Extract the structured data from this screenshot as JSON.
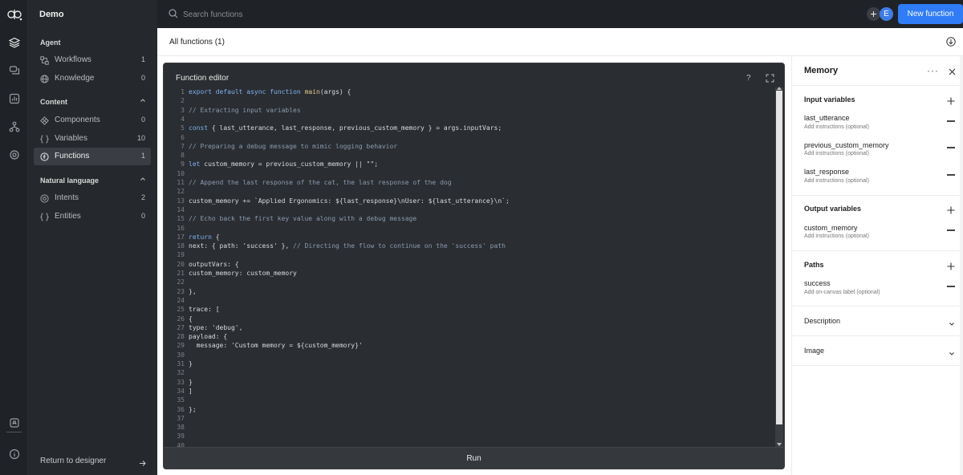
{
  "colors": {
    "accent": "#2f7cf6",
    "rail_bg": "#1f2226",
    "nav_bg": "#25282c",
    "editor_bg": "#2a2d31"
  },
  "sidebar": {
    "project_name": "Demo",
    "sections": [
      {
        "header": "Agent",
        "items": [
          {
            "label": "Workflows",
            "count": "1",
            "icon": "workflow-icon"
          },
          {
            "label": "Knowledge",
            "count": "0",
            "icon": "globe-icon"
          }
        ]
      },
      {
        "header": "Content",
        "items": [
          {
            "label": "Components",
            "count": "0",
            "icon": "component-icon"
          },
          {
            "label": "Variables",
            "count": "10",
            "icon": "braces-icon"
          },
          {
            "label": "Functions",
            "count": "1",
            "icon": "function-icon",
            "active": true
          }
        ]
      },
      {
        "header": "Natural language",
        "items": [
          {
            "label": "Intents",
            "count": "2",
            "icon": "intent-icon"
          },
          {
            "label": "Entities",
            "count": "0",
            "icon": "braces-icon"
          }
        ]
      }
    ],
    "return_label": "Return to designer"
  },
  "topbar": {
    "search_placeholder": "Search functions",
    "avatar_initial": "E",
    "new_button": "New function"
  },
  "subheader": {
    "title": "All functions (1)"
  },
  "editor": {
    "title": "Function editor",
    "help": "?",
    "run_label": "Run",
    "lines": [
      "export default async function main(args) {",
      "",
      "// Extracting input variables",
      "",
      "const { last_utterance, last_response, previous_custom_memory } = args.inputVars;",
      "",
      "// Preparing a debug message to mimic logging behavior",
      "",
      "let custom_memory = previous_custom_memory || \"\";",
      "",
      "// Append the last response of the cat, the last response of the dog",
      "",
      "custom_memory += `Applied Ergonomics: ${last_response}\\nUser: ${last_utterance}\\n`;",
      "",
      "// Echo back the first key value along with a debug message",
      "",
      "return {",
      "next: { path: 'success' }, // Directing the flow to continue on the 'success' path",
      "",
      "outputVars: {",
      "custom_memory: custom_memory",
      "",
      "},",
      "",
      "trace: [",
      "{",
      "type: 'debug',",
      "payload: {",
      "  message: 'Custom memory = ${custom_memory}'",
      "",
      "}",
      "",
      "}",
      "]",
      "",
      "};",
      "",
      "",
      "",
      ""
    ]
  },
  "panel": {
    "title": "Memory",
    "more": "···",
    "input_header": "Input variables",
    "inputs": [
      {
        "name": "last_utterance",
        "hint": "Add instructions (optional)"
      },
      {
        "name": "previous_custom_memory",
        "hint": "Add instructions (optional)"
      },
      {
        "name": "last_response",
        "hint": "Add instructions (optional)"
      }
    ],
    "output_header": "Output variables",
    "outputs": [
      {
        "name": "custom_memory",
        "hint": "Add instructions (optional)"
      }
    ],
    "paths_header": "Paths",
    "paths": [
      {
        "name": "success",
        "hint": "Add on-canvas label (optional)"
      }
    ],
    "description_label": "Description",
    "image_label": "Image"
  }
}
